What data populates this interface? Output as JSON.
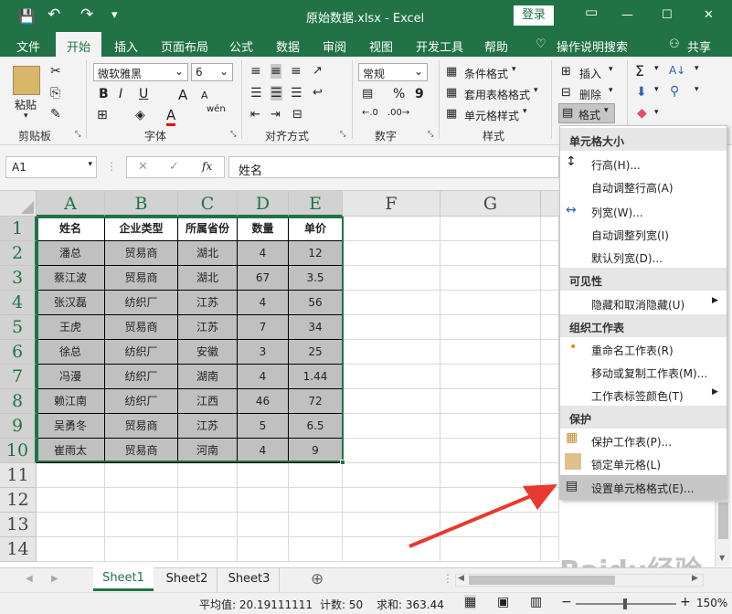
{
  "window": {
    "title": "原始数据.xlsx  -  Excel",
    "login": "登录",
    "minimize": "—",
    "restore": "☐",
    "close": "✕"
  },
  "qat": {
    "save": "💾",
    "undo": "↶",
    "redo": "↷",
    "custom": "▾"
  },
  "ribbon_tabs": [
    "文件",
    "开始",
    "插入",
    "页面布局",
    "公式",
    "数据",
    "审阅",
    "视图",
    "开发工具",
    "帮助"
  ],
  "tell_me": "操作说明搜索",
  "share": "共享",
  "groups": {
    "clipboard": "剪贴板",
    "font": "字体",
    "alignment": "对齐方式",
    "number": "数字",
    "styles": "样式"
  },
  "clipboard": {
    "paste": "粘贴"
  },
  "font": {
    "name": "微软雅黑",
    "size": "6",
    "bold": "B",
    "italic": "I",
    "underline": "U",
    "grow": "A",
    "shrink": "A",
    "wen": "wén",
    "color_a": "A"
  },
  "number": {
    "format": "常规",
    "percent": "%",
    "comma": "9"
  },
  "styles": {
    "cond": "条件格式",
    "table": "套用表格格式",
    "cell": "单元格样式"
  },
  "cells": {
    "insert": "插入",
    "delete": "删除",
    "format": "格式"
  },
  "formula": {
    "name_box": "A1",
    "fx": "fx",
    "value": "姓名"
  },
  "columns": [
    "A",
    "B",
    "C",
    "D",
    "E",
    "F",
    "G"
  ],
  "rows": [
    "1",
    "2",
    "3",
    "4",
    "5",
    "6",
    "7",
    "8",
    "9",
    "10",
    "11",
    "12",
    "13",
    "14"
  ],
  "table": {
    "header": [
      "姓名",
      "企业类型",
      "所属省份",
      "数量",
      "单价"
    ],
    "rows": [
      [
        "潘总",
        "贸易商",
        "湖北",
        "4",
        "12"
      ],
      [
        "蔡江波",
        "贸易商",
        "湖北",
        "67",
        "3.5"
      ],
      [
        "张汉磊",
        "纺织厂",
        "江苏",
        "4",
        "56"
      ],
      [
        "王虎",
        "贸易商",
        "江苏",
        "7",
        "34"
      ],
      [
        "徐总",
        "纺织厂",
        "安徽",
        "3",
        "25"
      ],
      [
        "冯漫",
        "纺织厂",
        "湖南",
        "4",
        "1.44"
      ],
      [
        "赖江南",
        "纺织厂",
        "江西",
        "46",
        "72"
      ],
      [
        "吴勇冬",
        "贸易商",
        "江苏",
        "5",
        "6.5"
      ],
      [
        "崔雨太",
        "贸易商",
        "河南",
        "4",
        "9"
      ]
    ]
  },
  "menu": {
    "sec_size": "单元格大小",
    "row_height": "行高(H)...",
    "autofit_row": "自动调整行高(A)",
    "col_width": "列宽(W)...",
    "autofit_col": "自动调整列宽(I)",
    "default_width": "默认列宽(D)...",
    "sec_visibility": "可见性",
    "hide_unhide": "隐藏和取消隐藏(U)",
    "sec_organize": "组织工作表",
    "rename": "重命名工作表(R)",
    "move_copy": "移动或复制工作表(M)...",
    "tab_color": "工作表标签颜色(T)",
    "sec_protect": "保护",
    "protect_sheet": "保护工作表(P)...",
    "lock_cell": "锁定单元格(L)",
    "format_cells": "设置单元格格式(E)..."
  },
  "sheets": [
    "Sheet1",
    "Sheet2",
    "Sheet3"
  ],
  "add_sheet": "⊕",
  "status": {
    "average": "平均值: 20.19111111",
    "count": "计数: 50",
    "sum": "求和: 363.44",
    "zoom": "150%",
    "minus": "−",
    "plus": "+"
  },
  "watermark": "Baidu经验",
  "colors": {
    "excel_green": "#217346",
    "data_fill": "#c0c0c0",
    "arrow": "#e8392e",
    "menu_hover": "#c6c6c6"
  }
}
